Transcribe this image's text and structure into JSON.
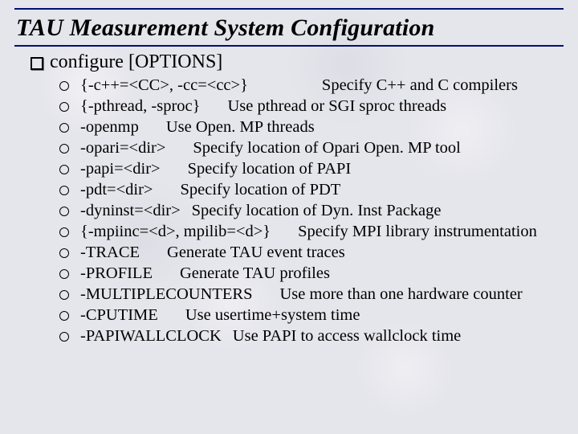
{
  "title": "TAU Measurement System Configuration",
  "configure_line": "configure [OPTIONS]",
  "opts": [
    {
      "opt": "{-c++=<CC>, -cc=<cc>}",
      "sep": "lg",
      "desc": "Specify C++ and C compilers"
    },
    {
      "opt": "{-pthread, -sproc}",
      "sep": "md",
      "desc": "Use pthread or SGI sproc threads"
    },
    {
      "opt": "-openmp",
      "sep": "md",
      "desc": "Use Open. MP threads"
    },
    {
      "opt": "-opari=<dir>",
      "sep": "md",
      "desc": "Specify location of Opari Open. MP tool"
    },
    {
      "opt": "-papi=<dir>",
      "sep": "md",
      "desc": "Specify location of PAPI"
    },
    {
      "opt": "-pdt=<dir>",
      "sep": "md",
      "desc": "Specify location of PDT"
    },
    {
      "opt": "-dyninst=<dir>",
      "sep": "sm",
      "desc": "Specify location of Dyn. Inst Package"
    },
    {
      "opt": "{-mpiinc=<d>, mpilib=<d>}",
      "sep": "md",
      "desc": "Specify MPI library instrumentation"
    },
    {
      "opt": "-TRACE",
      "sep": "md",
      "desc": "Generate TAU event traces"
    },
    {
      "opt": "-PROFILE",
      "sep": "md",
      "desc": "Generate TAU profiles"
    },
    {
      "opt": "-MULTIPLECOUNTERS",
      "sep": "md",
      "desc": "Use more than one hardware counter"
    },
    {
      "opt": "-CPUTIME",
      "sep": "md",
      "desc": "Use usertime+system time"
    },
    {
      "opt": "-PAPIWALLCLOCK",
      "sep": "sm",
      "desc": "Use PAPI to access wallclock time"
    }
  ]
}
